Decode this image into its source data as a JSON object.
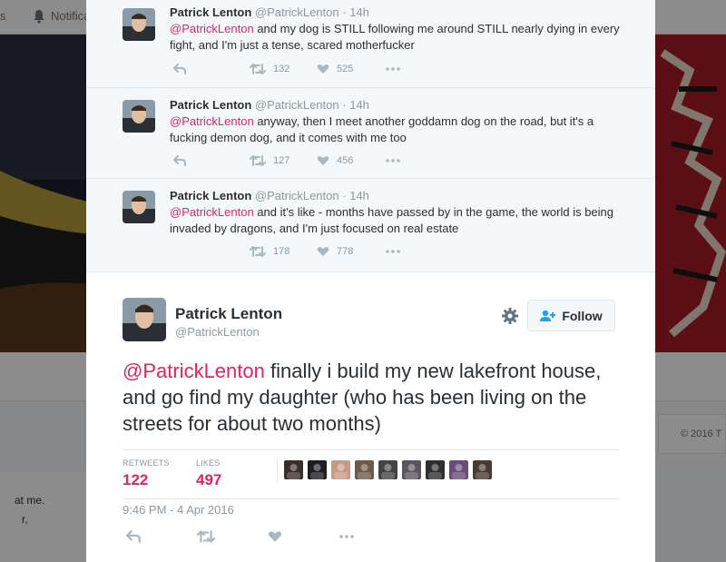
{
  "background": {
    "nav_fragments": [
      "s",
      "Notifica"
    ],
    "left_card_fragments": [
      "at me.",
      "r,"
    ],
    "copyright": "© 2016 T"
  },
  "ancestor_tweets": [
    {
      "name": "Patrick Lenton",
      "handle": "@PatrickLenton",
      "time": "14h",
      "mention": "@PatrickLenton",
      "text": " and my dog is STILL following me around STILL nearly dying in every fight, and I'm just a tense, scared motherfucker",
      "retweets": "132",
      "likes": "525"
    },
    {
      "name": "Patrick Lenton",
      "handle": "@PatrickLenton",
      "time": "14h",
      "mention": "@PatrickLenton",
      "text": " anyway, then I meet another goddamn dog on the road, but it's a fucking demon dog, and it comes with me too",
      "retweets": "127",
      "likes": "456"
    },
    {
      "name": "Patrick Lenton",
      "handle": "@PatrickLenton",
      "time": "14h",
      "mention": "@PatrickLenton",
      "text": " and it's like - months have passed by in the game, the world is being invaded by dragons, and I'm just focused on real estate",
      "retweets": "178",
      "likes": "778"
    }
  ],
  "main_tweet": {
    "name": "Patrick Lenton",
    "handle": "@PatrickLenton",
    "follow_label": "Follow",
    "mention": "@PatrickLenton",
    "text": " finally i build my new lakefront house, and go find my daughter (who has been living on the streets for about two months)",
    "retweets_label": "RETWEETS",
    "retweets": "122",
    "likes_label": "LIKES",
    "likes": "497",
    "timestamp": "9:46 PM - 4 Apr 2016",
    "liker_colors": [
      "#3a2d2a",
      "#1d1d22",
      "#c79a83",
      "#6d5a45",
      "#444444",
      "#5a5560",
      "#2f2f2f",
      "#6a4b7a",
      "#4a3a32"
    ]
  },
  "icons": {
    "reply": "reply-icon",
    "retweet": "retweet-icon",
    "like": "heart-icon",
    "more": "more-icon",
    "settings": "gear-icon",
    "follow": "follow-person-icon",
    "notifications": "bell-icon"
  },
  "colors": {
    "mention": "#e0245e",
    "stat_value": "#e0245e",
    "muted": "#8899a6",
    "text": "#292f33"
  }
}
